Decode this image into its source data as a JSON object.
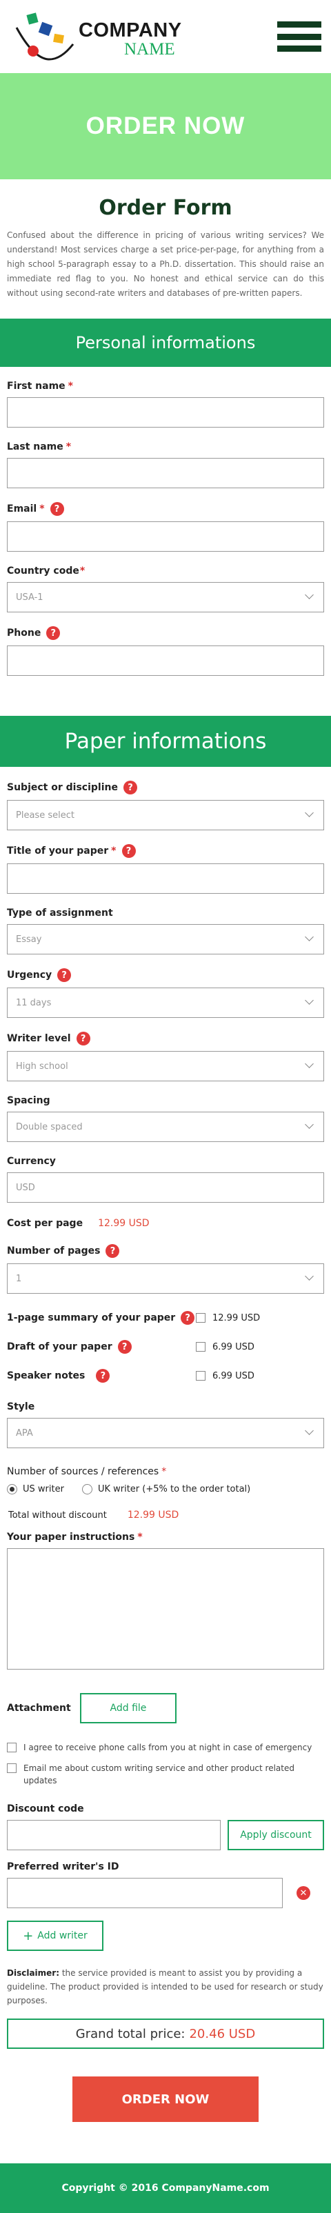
{
  "header": {
    "logo": {
      "company": "COMPANY",
      "name": "NAME"
    },
    "menu_icon": "hamburger-menu-icon"
  },
  "hero": {
    "title": "ORDER NOW"
  },
  "form": {
    "title": "Order Form",
    "intro": "Confused about the difference in pricing of various writing services? We understand!  Most services charge a set price-per-page, for anything from a high school 5-paragraph essay to a Ph.D. dissertation. This should raise an immediate red flag to you.  No honest and ethical service can do this without using second-rate writers and databases of pre-written papers."
  },
  "personal": {
    "heading": "Personal informations",
    "first_name": {
      "label": "First name",
      "value": ""
    },
    "last_name": {
      "label": "Last name",
      "value": ""
    },
    "email": {
      "label": "Email",
      "value": ""
    },
    "country_code": {
      "label": "Country code",
      "value": "USA-1"
    },
    "phone": {
      "label": "Phone",
      "value": ""
    }
  },
  "paper": {
    "heading": "Paper informations",
    "subject": {
      "label": "Subject or discipline",
      "value": "Please select"
    },
    "title": {
      "label": "Title of your paper",
      "value": ""
    },
    "assignment": {
      "label": "Type of assignment",
      "value": "Essay"
    },
    "urgency": {
      "label": "Urgency",
      "value": "11 days"
    },
    "writer_level": {
      "label": "Writer level",
      "value": "High school"
    },
    "spacing": {
      "label": "Spacing",
      "value": "Double spaced"
    },
    "currency": {
      "label": "Currency",
      "value": "USD"
    },
    "cost_per_page": {
      "label": "Cost per page",
      "value": "12.99 USD"
    },
    "pages": {
      "label": "Number of pages",
      "value": "1"
    },
    "extras": [
      {
        "label": "1-page summary of your paper",
        "price": "12.99 USD",
        "checked": false
      },
      {
        "label": "Draft of your paper",
        "price": "6.99 USD",
        "checked": false
      },
      {
        "label": "Speaker notes",
        "price": "6.99 USD",
        "checked": false
      }
    ],
    "style": {
      "label": "Style",
      "value": "APA"
    },
    "sources": {
      "label": "Number of sources / references",
      "us_writer": "US writer",
      "uk_writer": "UK writer (+5% to the order total)",
      "selected": "us_writer"
    },
    "total_without_discount": {
      "label": "Total without discount",
      "value": "12.99 USD"
    },
    "instructions": {
      "label": "Your paper instructions",
      "value": ""
    },
    "attachment": {
      "label": "Attachment",
      "button": "Add file"
    },
    "consent_phone": "I agree to receive phone calls from you at night in case of emergency",
    "consent_email": "Email me about custom writing service and other product related updates",
    "discount": {
      "label": "Discount code",
      "value": "",
      "button": "Apply discount"
    },
    "writer_id": {
      "label": "Preferred writer's ID",
      "value": "",
      "add_button": "Add writer",
      "remove_icon": "remove-icon"
    },
    "disclaimer_title": "Disclaimer:",
    "disclaimer_text": " the service provided is meant to assist you by providing a guideline. The product provided is intended to be used for research or study purposes.",
    "grand_total": {
      "label": "Grand total price:",
      "value": "20.46 USD"
    },
    "order_button": "ORDER NOW"
  },
  "footer": {
    "text": "Copyright © 2016 CompanyName.com"
  },
  "colors": {
    "accent": "#1aa35f",
    "hero": "#8be78b",
    "danger": "#e74c3c",
    "navy": "#103c1f"
  }
}
